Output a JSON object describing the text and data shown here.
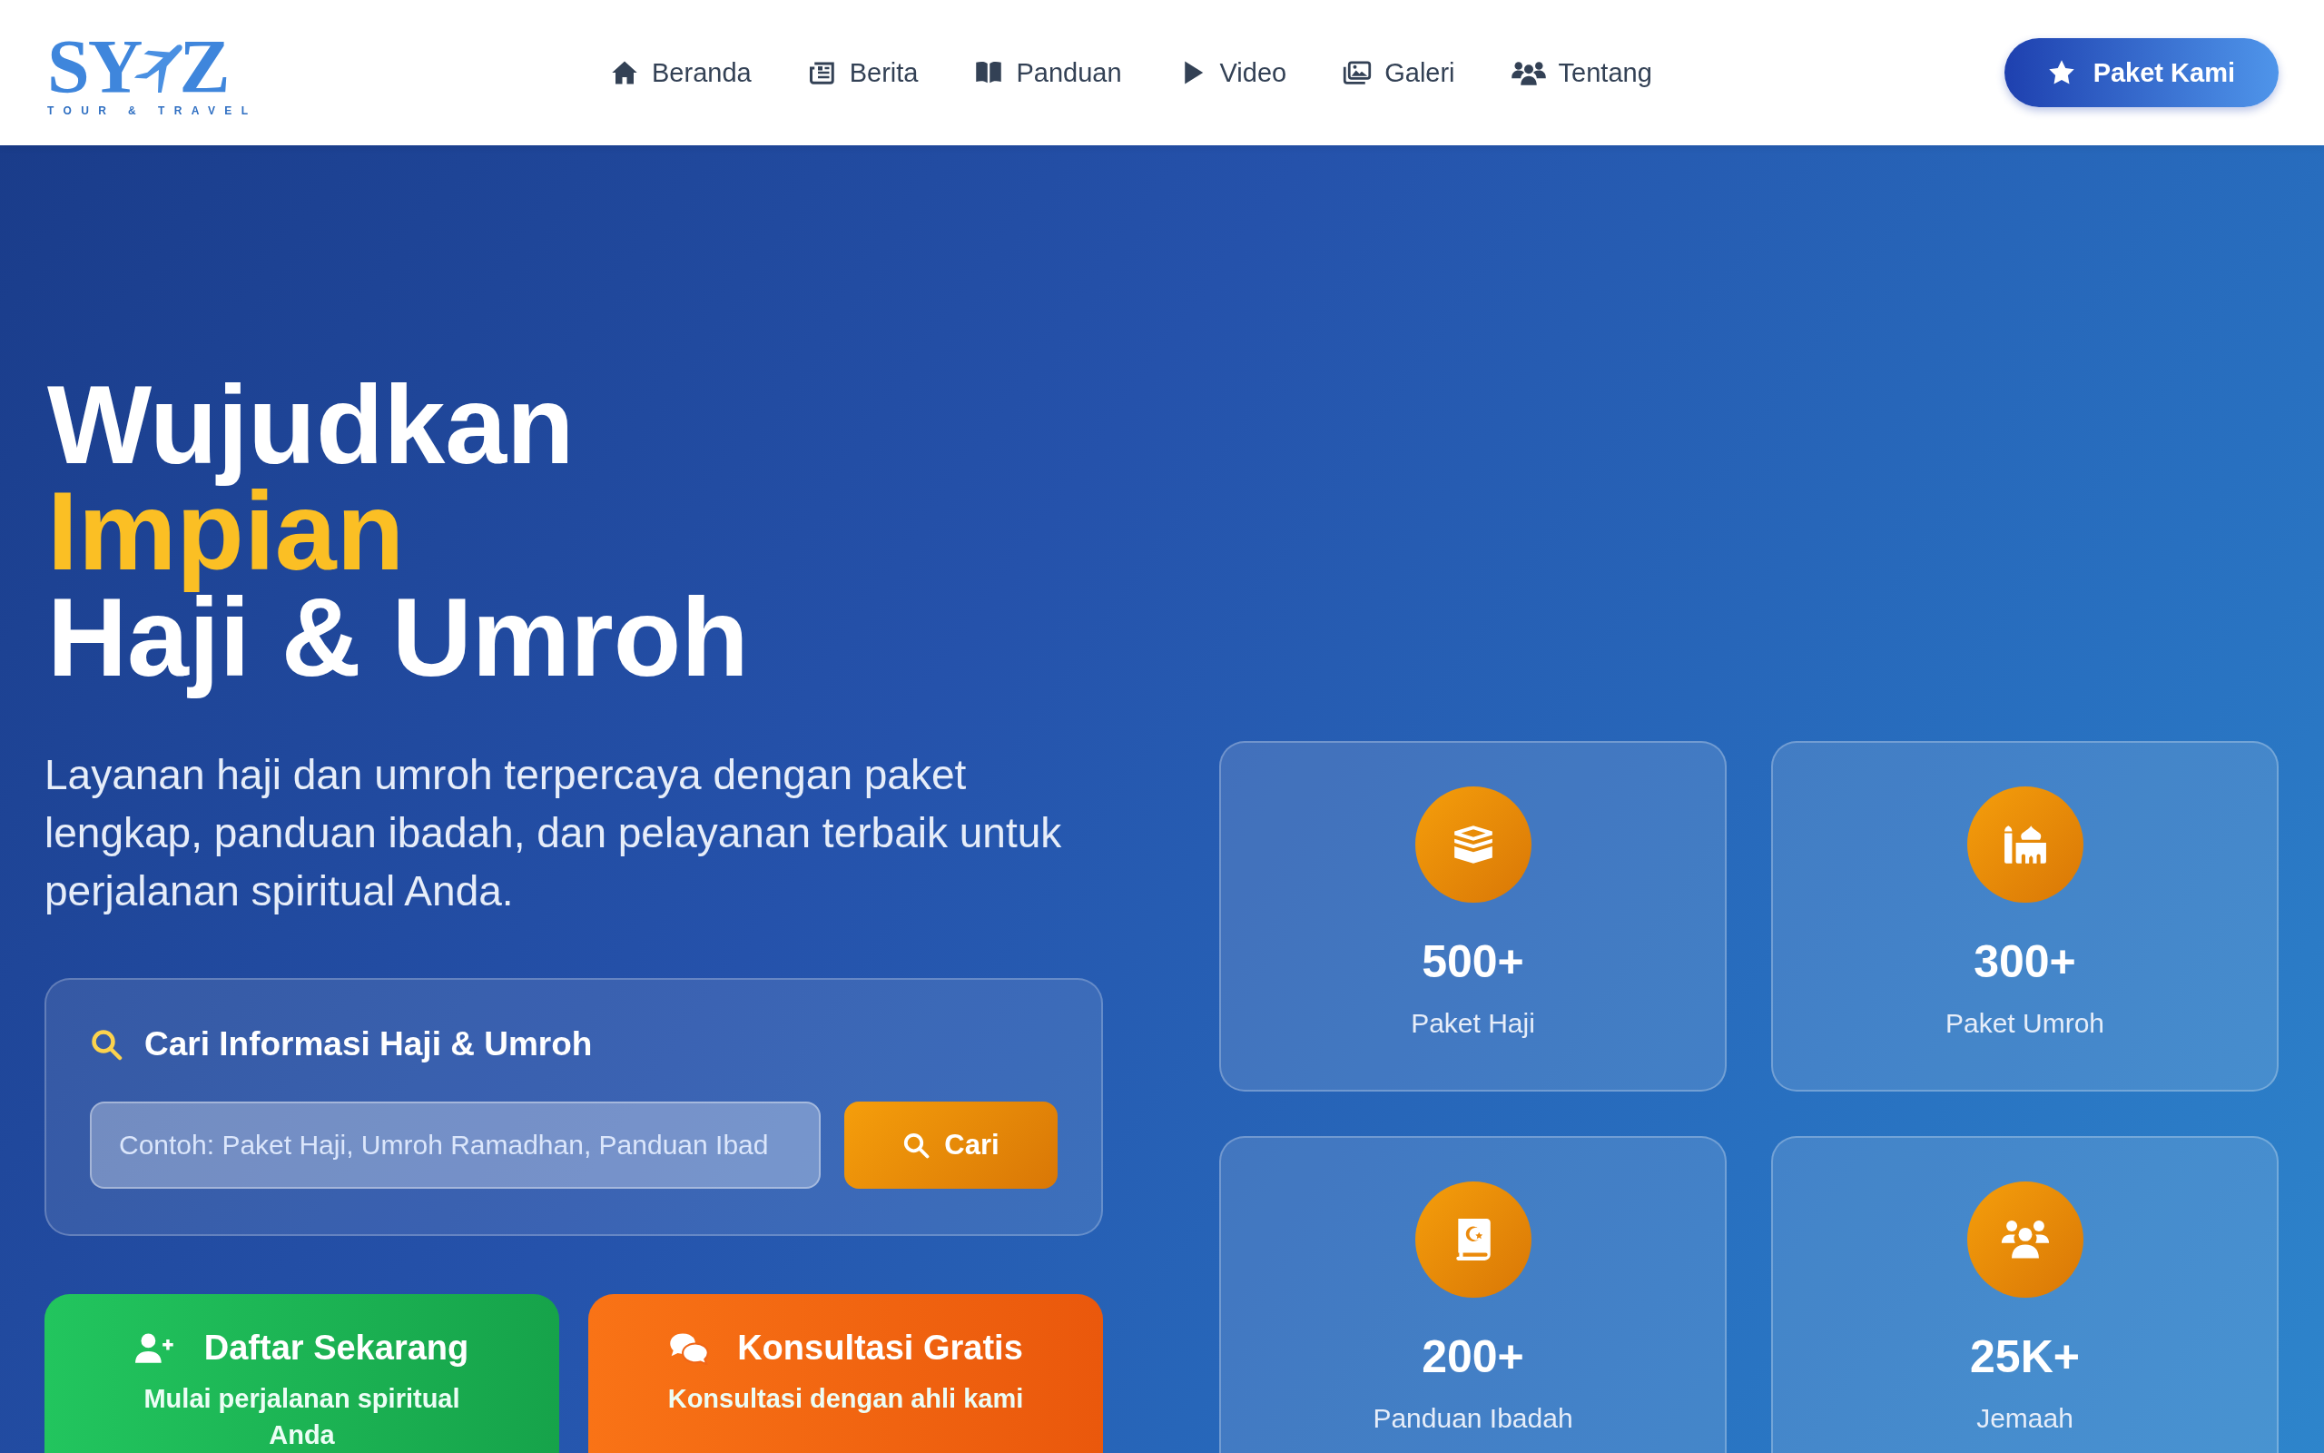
{
  "logo": {
    "letters_left": "SY",
    "letters_right": "Z",
    "tagline": "TOUR & TRAVEL"
  },
  "nav": [
    {
      "label": "Beranda"
    },
    {
      "label": "Berita"
    },
    {
      "label": "Panduan"
    },
    {
      "label": "Video"
    },
    {
      "label": "Galeri"
    },
    {
      "label": "Tentang"
    }
  ],
  "cta_button": {
    "label": "Paket Kami"
  },
  "hero": {
    "title_lines": [
      {
        "text": "Wujudkan",
        "highlight": false
      },
      {
        "text": "Impian",
        "highlight": true
      },
      {
        "text": "Haji & Umroh",
        "highlight": false
      }
    ],
    "description": "Layanan haji dan umroh terpercaya dengan paket lengkap, panduan ibadah, dan pelayanan terbaik untuk perjalanan spiritual Anda."
  },
  "search": {
    "title": "Cari Informasi Haji & Umroh",
    "placeholder": "Contoh: Paket Haji, Umroh Ramadhan, Panduan Ibad",
    "button": "Cari"
  },
  "actions": [
    {
      "title": "Daftar Sekarang",
      "subtitle": "Mulai perjalanan spiritual Anda"
    },
    {
      "title": "Konsultasi Gratis",
      "subtitle": "Konsultasi dengan ahli kami"
    }
  ],
  "stats": [
    {
      "value": "500+",
      "label": "Paket Haji"
    },
    {
      "value": "300+",
      "label": "Paket Umroh"
    },
    {
      "value": "200+",
      "label": "Panduan Ibadah"
    },
    {
      "value": "25K+",
      "label": "Jemaah"
    }
  ]
}
